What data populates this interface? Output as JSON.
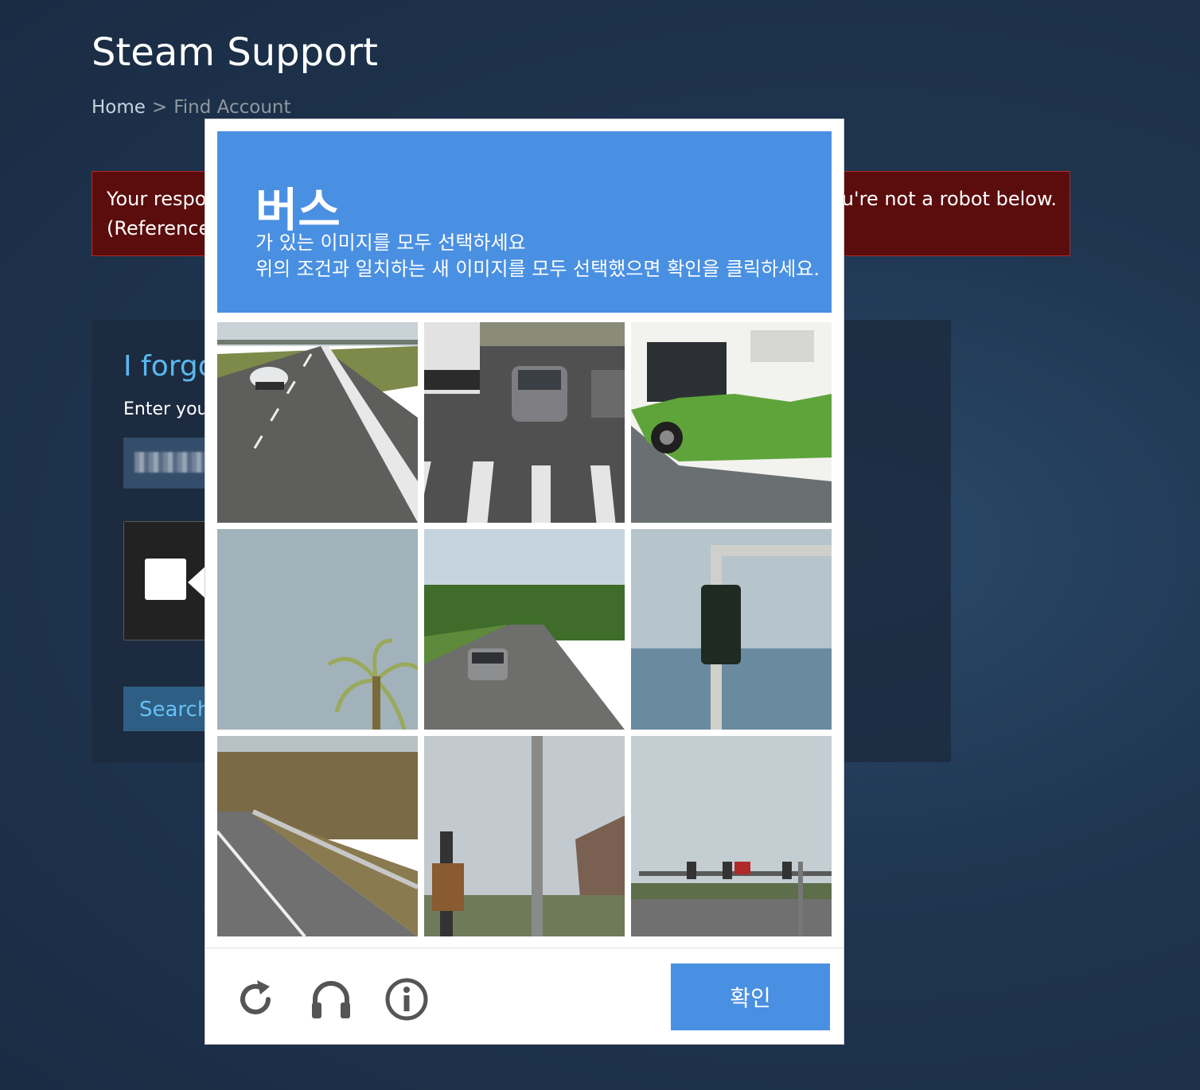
{
  "header": {
    "title": "Steam Support"
  },
  "breadcrumb": {
    "home": "Home",
    "separator": ">",
    "current": "Find Account"
  },
  "error": {
    "line1_start": "Your respo",
    "line2_start": "(Reference",
    "line1_end": "u're not a robot below."
  },
  "form": {
    "heading": "I forgo",
    "label": "Enter you",
    "search_label": "Search"
  },
  "captcha": {
    "keyword": "버스",
    "instruction_line1": "가 있는 이미지를 모두 선택하세요",
    "instruction_line2": "위의 조건과 일치하는 새 이미지를 모두 선택했으면 확인을 클릭하세요.",
    "verify_label": "확인",
    "header_color": "#4a90e2",
    "tiles": [
      {
        "scene": "highway-car"
      },
      {
        "scene": "intersection-cars"
      },
      {
        "scene": "bus"
      },
      {
        "scene": "sky-palm"
      },
      {
        "scene": "road-trees-car"
      },
      {
        "scene": "traffic-light-sea"
      },
      {
        "scene": "road-guardrail-trees"
      },
      {
        "scene": "pole-street"
      },
      {
        "scene": "traffic-lights-road"
      }
    ],
    "icons": [
      "reload-icon",
      "headphones-icon",
      "info-icon"
    ]
  },
  "colors": {
    "error_bg": "#5b0d0d",
    "accent": "#66c0f4",
    "verify": "#4a90e2"
  }
}
